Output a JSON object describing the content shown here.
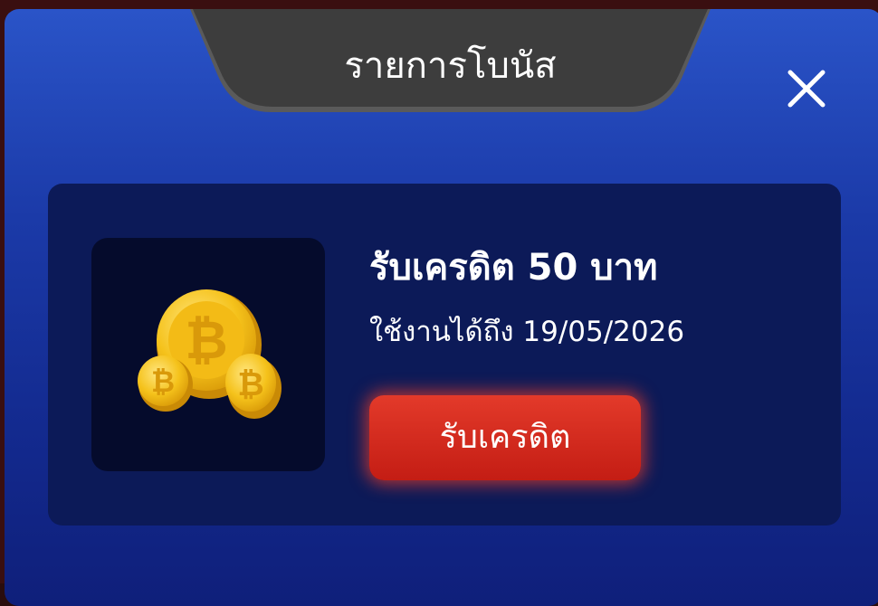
{
  "modal": {
    "title": "รายการโบนัส",
    "close_icon": "close-icon"
  },
  "bonus": {
    "title": "รับเครดิต 50 บาท",
    "expiry": "ใช้งานได้ถึง 19/05/2026",
    "claim_label": "รับเครดิต",
    "image_icon": "bitcoin-coins-icon"
  },
  "colors": {
    "modal_top": "#2a54c8",
    "modal_bottom": "#0f1f7a",
    "card_bg": "#0c1a58",
    "button_red": "#d42a1c",
    "title_tab": "#3f3f3f"
  }
}
